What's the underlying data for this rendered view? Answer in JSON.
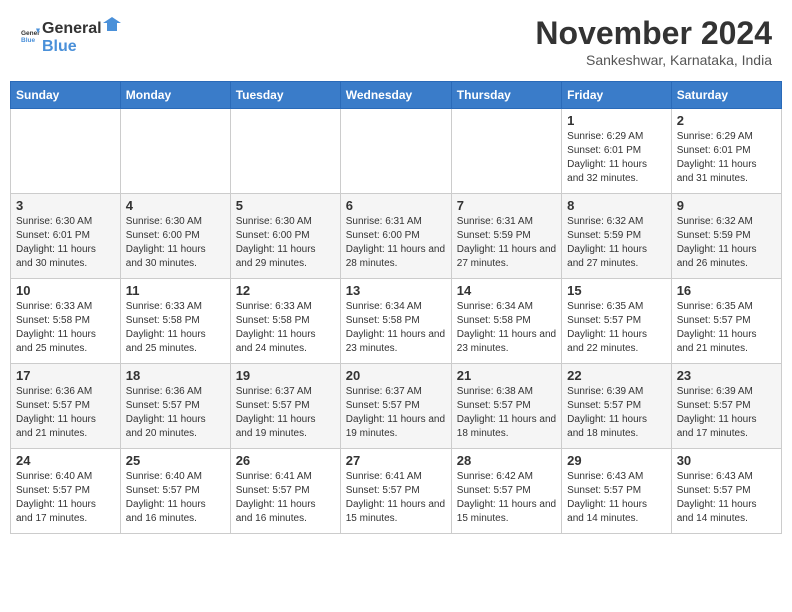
{
  "header": {
    "logo_general": "General",
    "logo_blue": "Blue",
    "month_title": "November 2024",
    "location": "Sankeshwar, Karnataka, India"
  },
  "days_of_week": [
    "Sunday",
    "Monday",
    "Tuesday",
    "Wednesday",
    "Thursday",
    "Friday",
    "Saturday"
  ],
  "weeks": [
    [
      {
        "day": "",
        "info": ""
      },
      {
        "day": "",
        "info": ""
      },
      {
        "day": "",
        "info": ""
      },
      {
        "day": "",
        "info": ""
      },
      {
        "day": "",
        "info": ""
      },
      {
        "day": "1",
        "info": "Sunrise: 6:29 AM\nSunset: 6:01 PM\nDaylight: 11 hours and 32 minutes."
      },
      {
        "day": "2",
        "info": "Sunrise: 6:29 AM\nSunset: 6:01 PM\nDaylight: 11 hours and 31 minutes."
      }
    ],
    [
      {
        "day": "3",
        "info": "Sunrise: 6:30 AM\nSunset: 6:01 PM\nDaylight: 11 hours and 30 minutes."
      },
      {
        "day": "4",
        "info": "Sunrise: 6:30 AM\nSunset: 6:00 PM\nDaylight: 11 hours and 30 minutes."
      },
      {
        "day": "5",
        "info": "Sunrise: 6:30 AM\nSunset: 6:00 PM\nDaylight: 11 hours and 29 minutes."
      },
      {
        "day": "6",
        "info": "Sunrise: 6:31 AM\nSunset: 6:00 PM\nDaylight: 11 hours and 28 minutes."
      },
      {
        "day": "7",
        "info": "Sunrise: 6:31 AM\nSunset: 5:59 PM\nDaylight: 11 hours and 27 minutes."
      },
      {
        "day": "8",
        "info": "Sunrise: 6:32 AM\nSunset: 5:59 PM\nDaylight: 11 hours and 27 minutes."
      },
      {
        "day": "9",
        "info": "Sunrise: 6:32 AM\nSunset: 5:59 PM\nDaylight: 11 hours and 26 minutes."
      }
    ],
    [
      {
        "day": "10",
        "info": "Sunrise: 6:33 AM\nSunset: 5:58 PM\nDaylight: 11 hours and 25 minutes."
      },
      {
        "day": "11",
        "info": "Sunrise: 6:33 AM\nSunset: 5:58 PM\nDaylight: 11 hours and 25 minutes."
      },
      {
        "day": "12",
        "info": "Sunrise: 6:33 AM\nSunset: 5:58 PM\nDaylight: 11 hours and 24 minutes."
      },
      {
        "day": "13",
        "info": "Sunrise: 6:34 AM\nSunset: 5:58 PM\nDaylight: 11 hours and 23 minutes."
      },
      {
        "day": "14",
        "info": "Sunrise: 6:34 AM\nSunset: 5:58 PM\nDaylight: 11 hours and 23 minutes."
      },
      {
        "day": "15",
        "info": "Sunrise: 6:35 AM\nSunset: 5:57 PM\nDaylight: 11 hours and 22 minutes."
      },
      {
        "day": "16",
        "info": "Sunrise: 6:35 AM\nSunset: 5:57 PM\nDaylight: 11 hours and 21 minutes."
      }
    ],
    [
      {
        "day": "17",
        "info": "Sunrise: 6:36 AM\nSunset: 5:57 PM\nDaylight: 11 hours and 21 minutes."
      },
      {
        "day": "18",
        "info": "Sunrise: 6:36 AM\nSunset: 5:57 PM\nDaylight: 11 hours and 20 minutes."
      },
      {
        "day": "19",
        "info": "Sunrise: 6:37 AM\nSunset: 5:57 PM\nDaylight: 11 hours and 19 minutes."
      },
      {
        "day": "20",
        "info": "Sunrise: 6:37 AM\nSunset: 5:57 PM\nDaylight: 11 hours and 19 minutes."
      },
      {
        "day": "21",
        "info": "Sunrise: 6:38 AM\nSunset: 5:57 PM\nDaylight: 11 hours and 18 minutes."
      },
      {
        "day": "22",
        "info": "Sunrise: 6:39 AM\nSunset: 5:57 PM\nDaylight: 11 hours and 18 minutes."
      },
      {
        "day": "23",
        "info": "Sunrise: 6:39 AM\nSunset: 5:57 PM\nDaylight: 11 hours and 17 minutes."
      }
    ],
    [
      {
        "day": "24",
        "info": "Sunrise: 6:40 AM\nSunset: 5:57 PM\nDaylight: 11 hours and 17 minutes."
      },
      {
        "day": "25",
        "info": "Sunrise: 6:40 AM\nSunset: 5:57 PM\nDaylight: 11 hours and 16 minutes."
      },
      {
        "day": "26",
        "info": "Sunrise: 6:41 AM\nSunset: 5:57 PM\nDaylight: 11 hours and 16 minutes."
      },
      {
        "day": "27",
        "info": "Sunrise: 6:41 AM\nSunset: 5:57 PM\nDaylight: 11 hours and 15 minutes."
      },
      {
        "day": "28",
        "info": "Sunrise: 6:42 AM\nSunset: 5:57 PM\nDaylight: 11 hours and 15 minutes."
      },
      {
        "day": "29",
        "info": "Sunrise: 6:43 AM\nSunset: 5:57 PM\nDaylight: 11 hours and 14 minutes."
      },
      {
        "day": "30",
        "info": "Sunrise: 6:43 AM\nSunset: 5:57 PM\nDaylight: 11 hours and 14 minutes."
      }
    ]
  ]
}
